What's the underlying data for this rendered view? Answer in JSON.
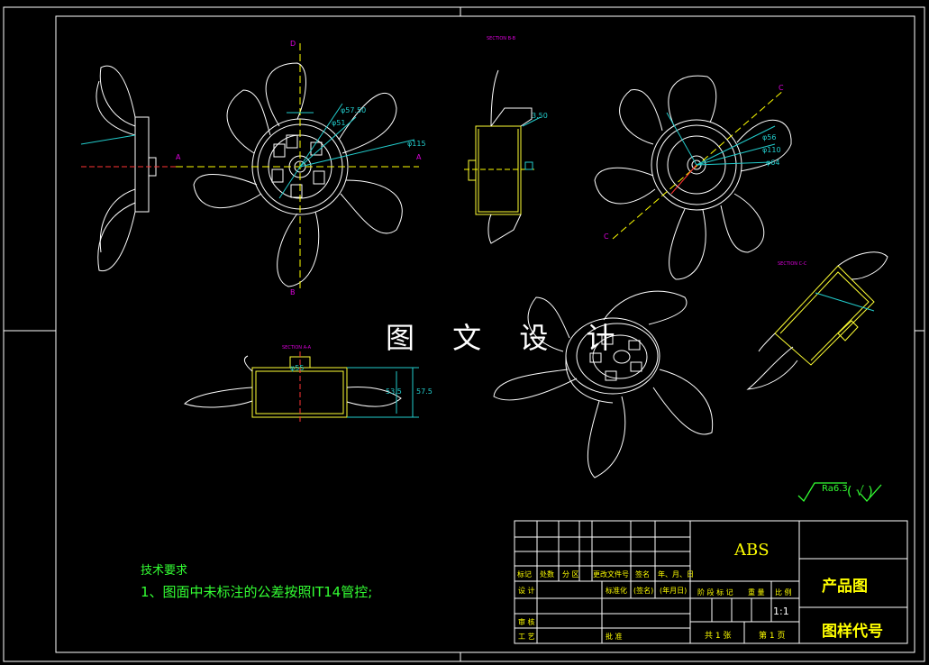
{
  "watermark": "图 文 设 计",
  "section_labels": {
    "bb": "SECTION B-B",
    "aa": "SECTION A-A",
    "cc": "SECTION C-C"
  },
  "view_letters": {
    "a": "A",
    "b": "B",
    "c": "C",
    "d": "D"
  },
  "dimensions": [
    "φ115",
    "φ57.50",
    "φ51",
    "φ110",
    "φ56",
    "φ64",
    "φ55",
    "3.50",
    "53.5",
    "57.5"
  ],
  "tech_requirements": {
    "title": "技术要求",
    "note": "1、图面中未标注的公差按照IT14管控;"
  },
  "roughness": {
    "value": "Ra6.3",
    "symbol_paren": "( √ )"
  },
  "title_block": {
    "row_headers": [
      "标记",
      "处数",
      "分 区",
      "更改文件号",
      "签名",
      "年、月、日"
    ],
    "design": "设 计",
    "standardize": "标准化",
    "sign": "(签名)",
    "date": "(年月日)",
    "review": "审 核",
    "process": "工 艺",
    "approve": "批 准",
    "stage_headers": [
      "阶 段 标 记",
      "重 量",
      "比 例"
    ],
    "material": "ABS",
    "scale": "1:1",
    "sheets": "共 1 张",
    "sheet_no": "第 1 页",
    "product": "产品图",
    "drawing_code": "图样代号"
  },
  "colors": {
    "outline": "#ffffff",
    "section_fill": "#ffff33",
    "dimension": "#22cccc",
    "centerline": "#ff3333",
    "axis": "#ffff00",
    "text_green": "#33ff33",
    "label_magenta": "#dd00dd"
  }
}
